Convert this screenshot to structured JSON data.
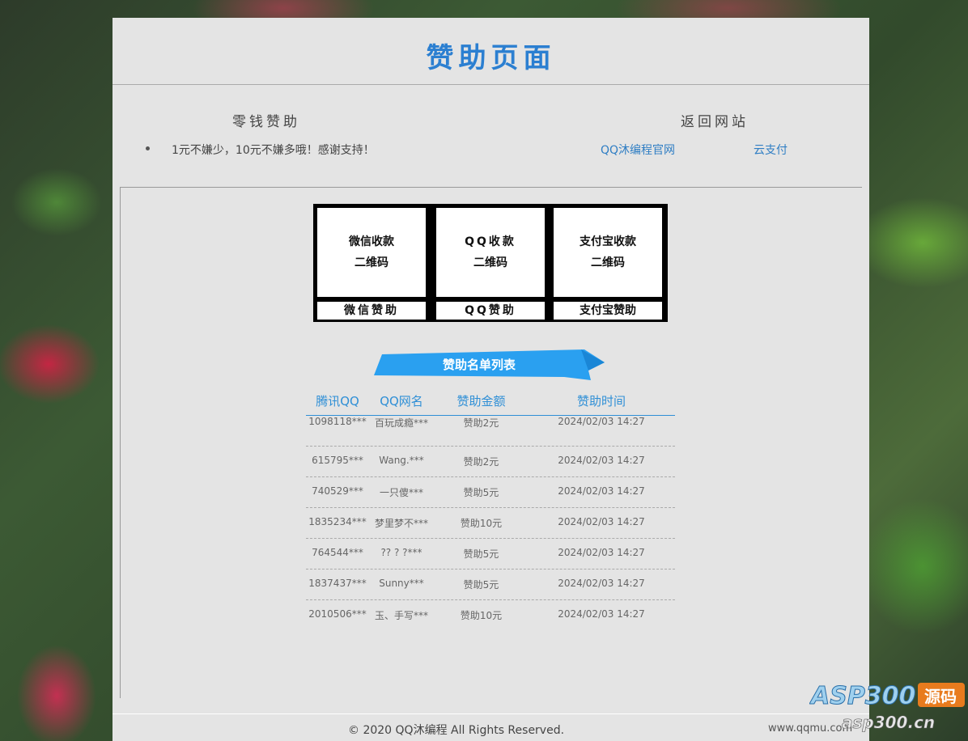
{
  "page": {
    "title": "赞助页面"
  },
  "left_section": {
    "heading": "零钱赞助",
    "note": "1元不嫌少，10元不嫌多哦！感谢支持！"
  },
  "right_section": {
    "heading": "返回网站",
    "links": [
      "QQ沐编程官网",
      "云支付"
    ]
  },
  "qr_codes": [
    {
      "line1": "微信收款",
      "line2": "二维码",
      "caption": "微信赞助"
    },
    {
      "line1": "QQ收款",
      "line2": "二维码",
      "caption": "QQ赞助"
    },
    {
      "line1": "支付宝收款",
      "line2": "二维码",
      "caption": "支付宝赞助"
    }
  ],
  "list": {
    "title": "赞助名单列表",
    "headers": [
      "腾讯QQ",
      "QQ网名",
      "赞助金额",
      "赞助时间"
    ],
    "rows": [
      [
        "1098118***",
        "百玩成瘾***",
        "赞助2元",
        "2024/02/03 14:27"
      ],
      [
        "615795***",
        "Wang.***",
        "赞助2元",
        "2024/02/03 14:27"
      ],
      [
        "740529***",
        "一只傻***",
        "赞助5元",
        "2024/02/03 14:27"
      ],
      [
        "1835234***",
        "梦里梦不***",
        "赞助10元",
        "2024/02/03 14:27"
      ],
      [
        "764544***",
        "?? ? ?***",
        "赞助5元",
        "2024/02/03 14:27"
      ],
      [
        "1837437***",
        "Sunny***",
        "赞助5元",
        "2024/02/03 14:27"
      ],
      [
        "2010506***",
        "玉、手写***",
        "赞助10元",
        "2024/02/03 14:27"
      ]
    ]
  },
  "footer": {
    "copyright": "© 2020 QQ沐编程 All Rights Reserved.",
    "url": "www.qqmu.com"
  },
  "watermark": {
    "brand": "ASP300",
    "tag": "源码",
    "domain": "asp300.cn"
  },
  "colors": {
    "accent": "#2b7fd1",
    "ribbon": "#2aa0f0",
    "panel": "#e4e4e4"
  }
}
